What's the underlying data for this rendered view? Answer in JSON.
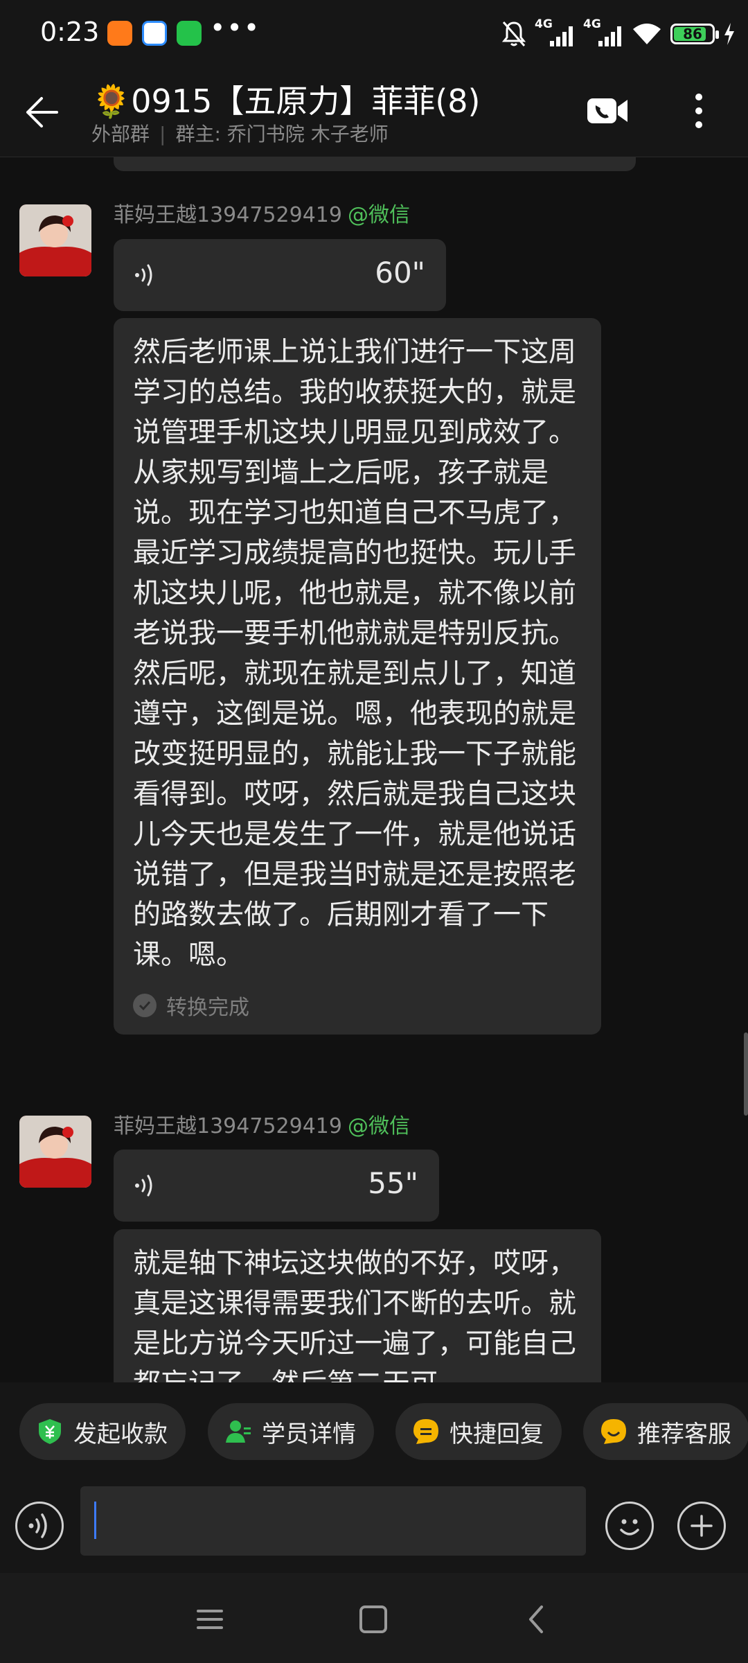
{
  "status_bar": {
    "time": "0:23",
    "network_left": "4G",
    "network_right": "4G",
    "battery": "86",
    "battery_level": 0.86,
    "overflow_glyph": "•••",
    "app_icons": [
      "taobao-icon",
      "chat-app-icon",
      "wechat-icon"
    ]
  },
  "header": {
    "emoji": "🌻",
    "title": "0915【五原力】菲菲(8)",
    "subtitle_left": "外部群",
    "subtitle_right": "群主: 乔门书院 木子老师"
  },
  "messages": [
    {
      "sender": "菲妈王越13947529419",
      "tag": "@微信",
      "voice_duration": "60\"",
      "transcript": "然后老师课上说让我们进行一下这周学习的总结。我的收获挺大的，就是说管理手机这块儿明显见到成效了。从家规写到墙上之后呢，孩子就是说。现在学习也知道自己不马虎了，最近学习成绩提高的也挺快。玩儿手机这块儿呢，他也就是，就不像以前老说我一要手机他就就是特别反抗。然后呢，就现在就是到点儿了，知道遵守，这倒是说。嗯，他表现的就是改变挺明显的，就能让我一下子就能看得到。哎呀，然后就是我自己这块儿今天也是发生了一件，就是他说话说错了，但是我当时就是还是按照老的路数去做了。后期刚才看了一下课。嗯。",
      "status": "转换完成"
    },
    {
      "sender": "菲妈王越13947529419",
      "tag": "@微信",
      "voice_duration": "55\"",
      "transcript": "就是轴下神坛这块做的不好，哎呀，真是这课得需要我们不断的去听。就是比方说今天听过一遍了，可能自己都忘记了，然后第二天可"
    }
  ],
  "quick_actions": [
    {
      "label": "发起收款",
      "icon": "payment-icon",
      "color": "#2fbf4f"
    },
    {
      "label": "学员详情",
      "icon": "user-icon",
      "color": "#2fbf4f"
    },
    {
      "label": "快捷回复",
      "icon": "quick-reply-icon",
      "color": "#f5b400"
    },
    {
      "label": "推荐客服",
      "icon": "support-icon",
      "color": "#f5b400"
    }
  ],
  "input": {
    "placeholder": ""
  },
  "colors": {
    "background": "#111111",
    "bubble": "#2b2b2b",
    "accent_green": "#4fbf5a"
  }
}
